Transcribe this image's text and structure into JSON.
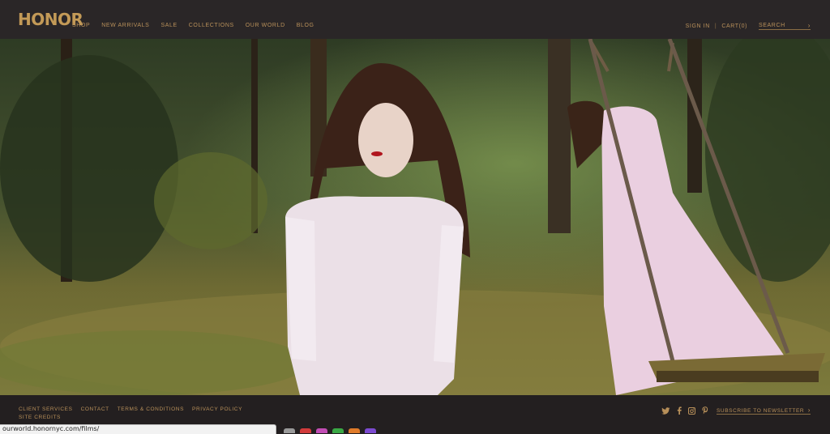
{
  "brand": {
    "logo": "HONOR",
    "accent": "#c39a57"
  },
  "nav": {
    "items": [
      "SHOP",
      "NEW ARRIVALS",
      "SALE",
      "COLLECTIONS",
      "OUR WORLD",
      "BLOG"
    ]
  },
  "utility": {
    "sign_in": "SIGN IN",
    "separator": "|",
    "cart": "CART(0)",
    "search_placeholder": "SEARCH",
    "search_chevron": "›"
  },
  "footer": {
    "links": [
      "CLIENT SERVICES",
      "CONTACT",
      "TERMS & CONDITIONS",
      "PRIVACY POLICY"
    ],
    "site_credits": "SITE CREDITS",
    "social_icons": [
      "twitter-icon",
      "facebook-icon",
      "instagram-icon",
      "pinterest-icon"
    ],
    "newsletter_label": "SUBSCRIBE TO NEWSLETTER",
    "newsletter_chevron": "›"
  },
  "status_bar": {
    "url": "ourworld.honornyc.com/films/"
  }
}
